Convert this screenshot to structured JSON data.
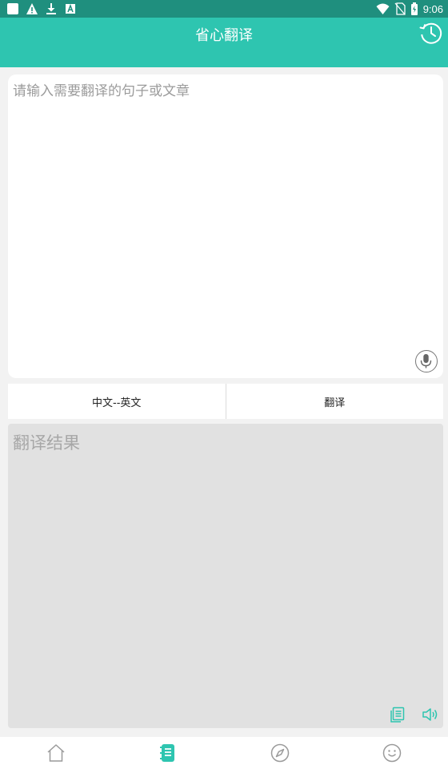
{
  "status_bar": {
    "time": "9:06"
  },
  "header": {
    "title": "省心翻译"
  },
  "input": {
    "placeholder": "请输入需要翻译的句子或文章"
  },
  "actions": {
    "language_pair": "中文--英文",
    "translate": "翻译"
  },
  "result": {
    "placeholder": "翻译结果"
  },
  "colors": {
    "accent": "#2ec5b0",
    "status_bar": "#1f8f7e",
    "result_bg": "#e1e1e1"
  },
  "nav": {
    "items": [
      "home-icon",
      "translate-book-icon",
      "compass-icon",
      "smiley-icon"
    ],
    "active_index": 1
  }
}
